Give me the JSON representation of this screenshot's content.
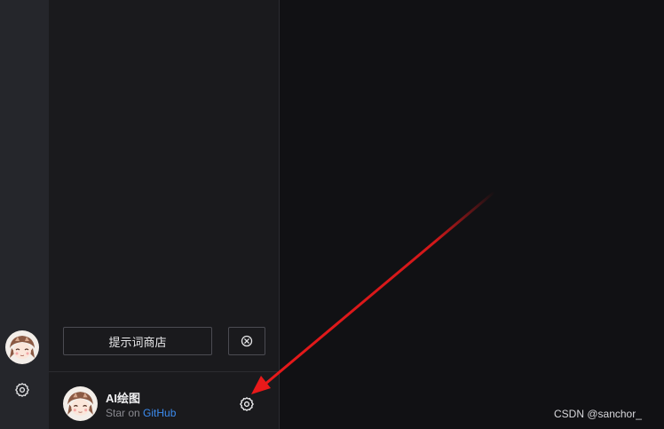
{
  "sidebar": {
    "prompt_store_label": "提示词商店",
    "clear_icon": "circle-x-icon"
  },
  "rail": {
    "avatar_icon": "anime-girl-avatar",
    "settings_icon": "gear-icon"
  },
  "profile": {
    "name": "AI绘图",
    "sub_prefix": "Star on",
    "sub_link": "GitHub",
    "settings_icon": "gear-icon"
  },
  "watermark": "CSDN @sanchor_",
  "colors": {
    "background": "#111114",
    "sidebar": "#1a1a1d",
    "rail": "#25262b",
    "link": "#3c8cf0",
    "annotation_arrow": "#e8191a"
  }
}
